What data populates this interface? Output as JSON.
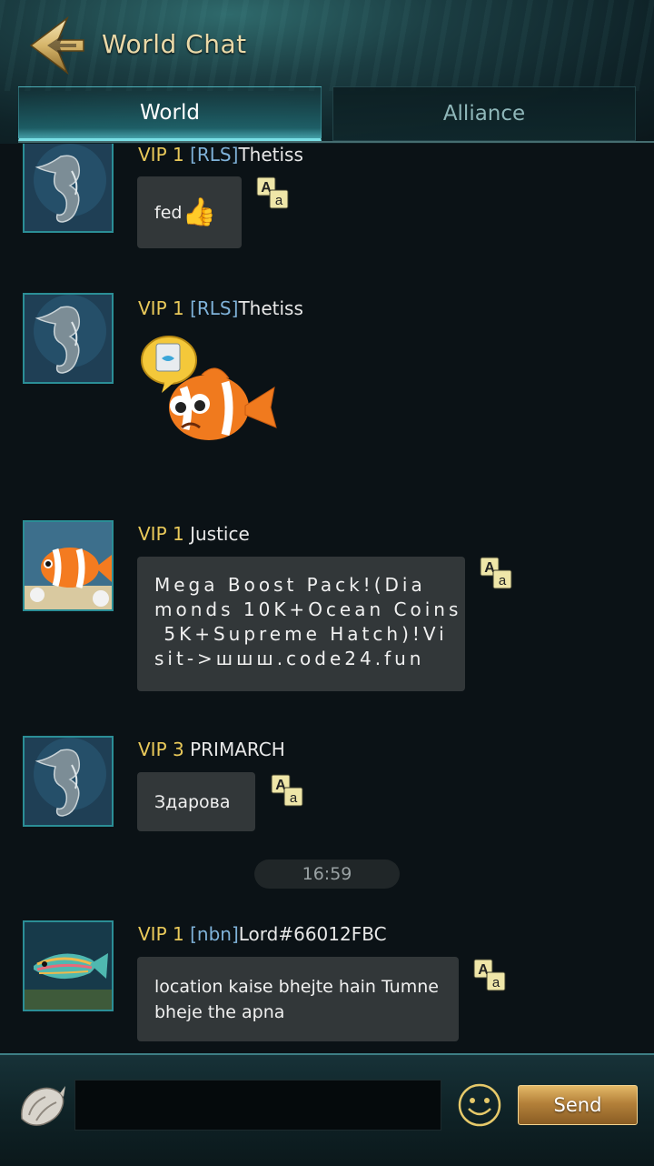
{
  "header": {
    "title": "World Chat",
    "back_icon": "arrow-back-icon"
  },
  "tabs": [
    {
      "label": "World",
      "active": true
    },
    {
      "label": "Alliance",
      "active": false
    }
  ],
  "messages": [
    {
      "vip": "VIP 1",
      "tag": "[RLS]",
      "name": "Thetiss",
      "text": "fed",
      "emoji": "👍",
      "avatar": "seahorse-avatar"
    },
    {
      "vip": "VIP 1",
      "tag": "[RLS]",
      "name": "Thetiss",
      "sticker": "clownfish-sticker",
      "avatar": "seahorse-avatar"
    },
    {
      "vip": "VIP 1",
      "tag": "",
      "name": "Justice",
      "text": "Mega Boost Pack!(Diamonds 10K+Ocean Coins 5K+Supreme Hatch)!Visit->www.code24.fun",
      "lines": [
        "Mega Boost Pack!(Dia",
        "monds 10K+Ocean Coins",
        " 5K+Supreme Hatch)!Vi",
        "sit->шшш.code24.fun"
      ],
      "avatar": "clownfish-avatar"
    },
    {
      "vip": "VIP 3",
      "tag": "",
      "name": "PRIMARCH",
      "text": "Здарова",
      "avatar": "seahorse-avatar"
    },
    {
      "vip": "VIP 1",
      "tag": "[nbn]",
      "name": "Lord#66012FBC",
      "text": "location kaise bhejte hain Tumne bheje the apna",
      "lines": [
        "location kaise bhejte hain Tumne",
        "bheje the apna"
      ],
      "avatar": "wrasse-fish-avatar"
    }
  ],
  "timestamp": "16:59",
  "footer": {
    "input_value": "",
    "send_label": "Send"
  },
  "colors": {
    "vip": "#e9c95a",
    "tag": "#7fb2d9",
    "accent": "#79e0e6",
    "send_button": "#b4813a"
  }
}
